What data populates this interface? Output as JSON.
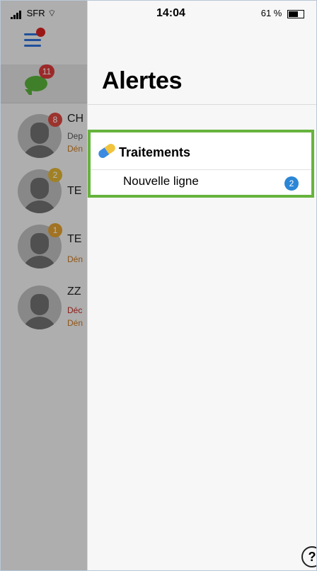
{
  "status_bar": {
    "carrier": "SFR",
    "time": "14:04",
    "battery": "61 %"
  },
  "left_list": {
    "chat_badge": "11",
    "rows": [
      {
        "title": "CH",
        "sub1": "Dep",
        "sub2": "Dén",
        "badge": "8"
      },
      {
        "title": "TE",
        "badge": "2"
      },
      {
        "title": "TE",
        "sub1": "Dén",
        "badge": "1"
      },
      {
        "title": "ZZ",
        "sub1": "Déc",
        "sub2": "Dén"
      }
    ]
  },
  "panel": {
    "title": "Alertes",
    "section": {
      "title": "Traitements",
      "items": [
        {
          "label": "Nouvelle ligne",
          "count": "2"
        }
      ]
    },
    "help_icon": "?"
  },
  "colors": {
    "accent_green": "#66b33d",
    "badge_blue": "#2b86d6"
  }
}
